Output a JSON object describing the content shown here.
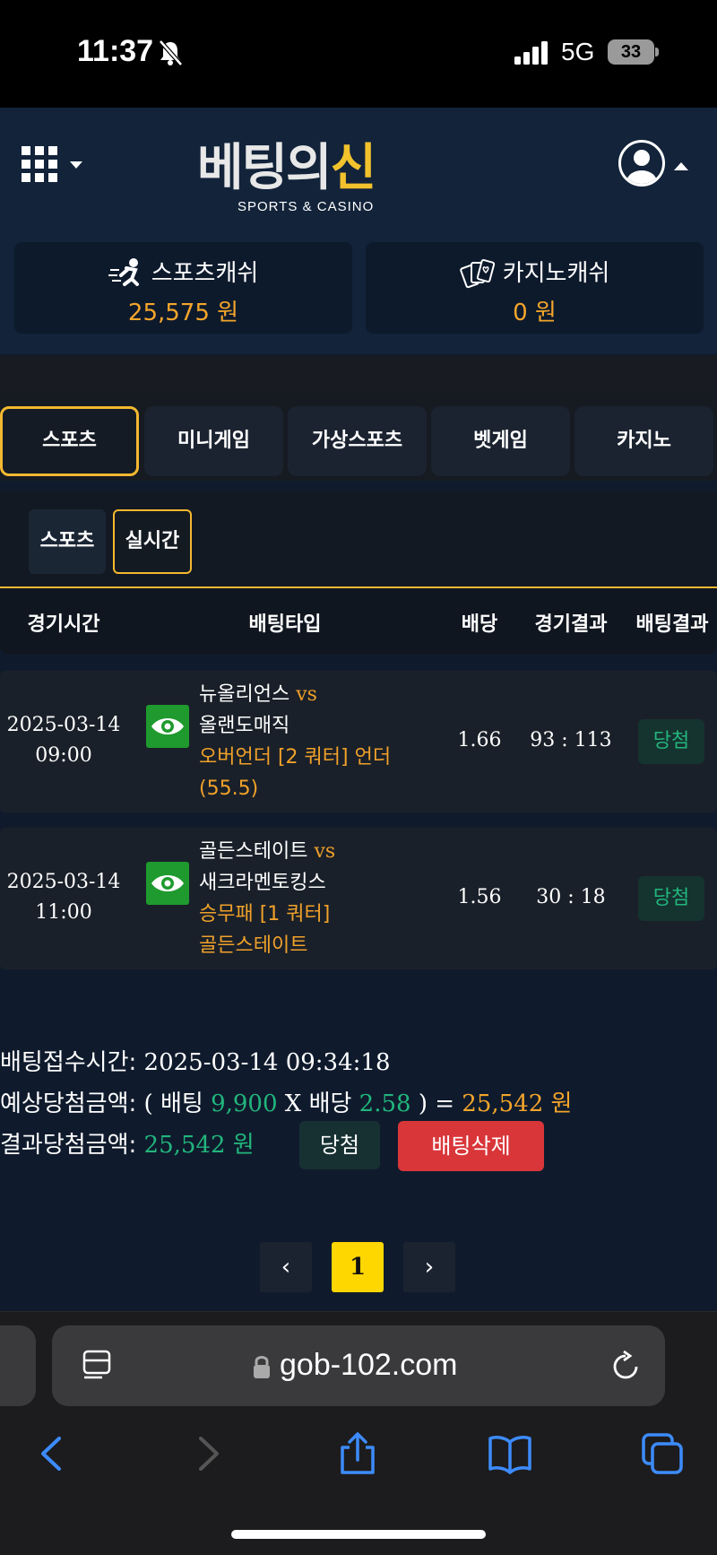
{
  "status_bar": {
    "time": "11:37",
    "network": "5G",
    "battery": "33"
  },
  "header": {
    "logo_main_left": "베팅의",
    "logo_main_right": "신",
    "logo_sub": "SPORTS & CASINO"
  },
  "wallets": [
    {
      "label": "스포츠캐쉬",
      "value": "25,575 원",
      "icon": "running-icon"
    },
    {
      "label": "카지노캐쉬",
      "value": "0 원",
      "icon": "cards-icon"
    }
  ],
  "tabs": [
    {
      "label": "스포츠",
      "active": true
    },
    {
      "label": "미니게임"
    },
    {
      "label": "가상스포츠"
    },
    {
      "label": "벳게임"
    },
    {
      "label": "카지노"
    }
  ],
  "subtabs": [
    {
      "label": "스포츠"
    },
    {
      "label": "실시간",
      "active": true
    }
  ],
  "table": {
    "headers": [
      "경기시간",
      "배팅타입",
      "배당",
      "경기결과",
      "배팅결과"
    ],
    "rows": [
      {
        "date": "2025-03-14",
        "time": "09:00",
        "home": "뉴올리언스",
        "vs": "vs",
        "away": "올랜도매직",
        "bet_line1": "오버언더 [2 쿼터] 언더",
        "bet_line2": "(55.5)",
        "odds": "1.66",
        "score": "93 : 113",
        "result": "당첨"
      },
      {
        "date": "2025-03-14",
        "time": "11:00",
        "home": "골든스테이트",
        "vs": "vs",
        "away": "새크라멘토킹스",
        "bet_line1": "승무패 [1 쿼터]",
        "bet_line2": "골든스테이트",
        "odds": "1.56",
        "score": "30 : 18",
        "result": "당첨"
      }
    ]
  },
  "summary": {
    "time_label": "배팅접수시간:",
    "time_value": "2025-03-14 09:34:18",
    "expected_label": "예상당첨금액:",
    "expected_open": "(",
    "bet_word": "배팅",
    "bet_amount": "9,900",
    "x_word": "X",
    "odds_word": "배당",
    "odds_value": "2.58",
    "expected_close": ") =",
    "expected_total": "25,542 원",
    "result_label": "결과당첨금액:",
    "result_value": "25,542 원",
    "win_button": "당첨",
    "delete_button": "배팅삭제"
  },
  "pagination": {
    "prev": "‹",
    "current": "1",
    "next": "›"
  },
  "browser": {
    "url": "gob-102.com"
  }
}
